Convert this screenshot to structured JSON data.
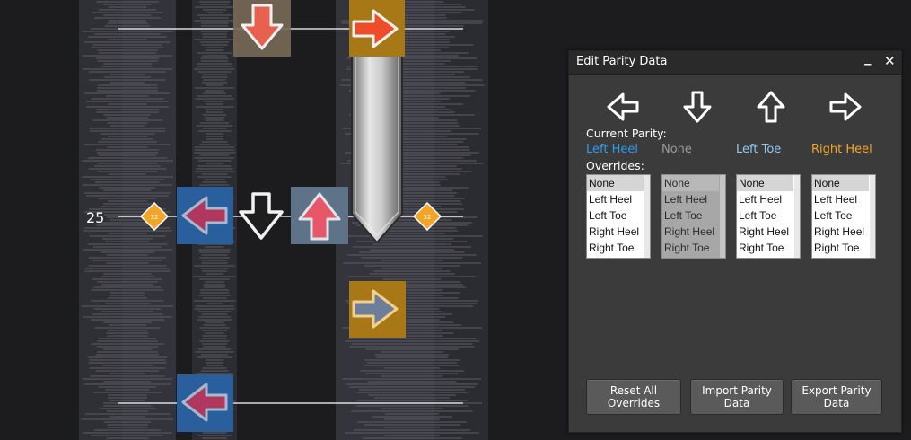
{
  "playfield": {
    "measure_number": "25",
    "snap_label": "32"
  },
  "panel": {
    "title": "Edit Parity Data",
    "minimize_symbol": "_",
    "close_symbol": "✕",
    "arrow_icons": [
      "arrow-left-icon",
      "arrow-down-icon",
      "arrow-up-icon",
      "arrow-right-icon"
    ],
    "current_parity_label": "Current Parity:",
    "current_parity": [
      "Left Heel",
      "None",
      "Left Toe",
      "Right Heel"
    ],
    "overrides_label": "Overrides:",
    "override_options": [
      "None",
      "Left Heel",
      "Left Toe",
      "Right Heel",
      "Right Toe"
    ],
    "selected_override": [
      "None",
      "None",
      "None",
      "None"
    ],
    "buttons": {
      "reset": [
        "Reset All",
        "Overrides"
      ],
      "import": [
        "Import Parity",
        "Data"
      ],
      "export": [
        "Export Parity",
        "Data"
      ]
    }
  },
  "colors": {
    "left_heel": "#2c9cf0",
    "none": "#9a9a9a",
    "left_toe": "#8ec8f0",
    "right_heel": "#f2a526",
    "quarter_note_bg": "#2a5f9e",
    "eighth_note_bg": "#a86e14",
    "up_note_bg": "#5e7388"
  }
}
